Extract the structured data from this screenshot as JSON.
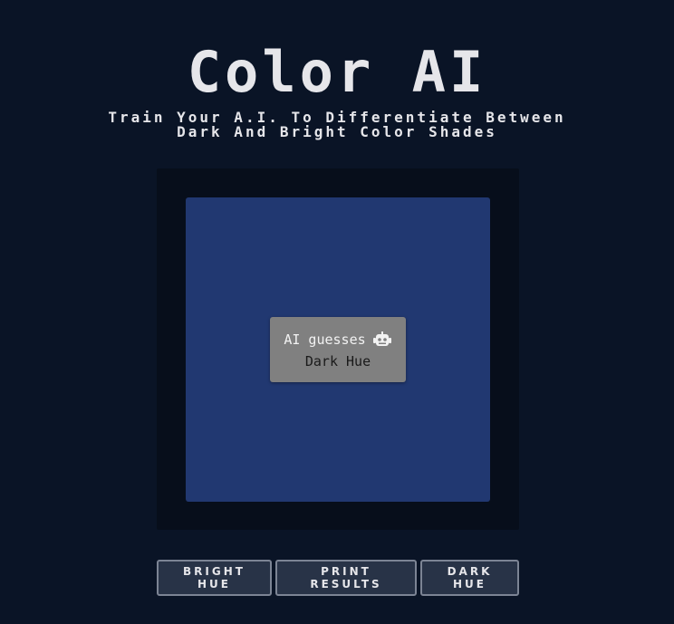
{
  "header": {
    "title": "Color AI",
    "subtitle_line1": "Train Your A.I. To Differentiate Between",
    "subtitle_line2": "Dark And Bright Color Shades"
  },
  "swatch": {
    "color": "#213871"
  },
  "guess": {
    "label": "AI guesses",
    "icon": "robot-icon",
    "value": "Dark Hue"
  },
  "buttons": {
    "bright": {
      "line1": "BRIGHT",
      "line2": "HUE"
    },
    "print": {
      "line1": "PRINT",
      "line2": "RESULTS"
    },
    "dark": {
      "line1": "DARK",
      "line2": "HUE"
    }
  },
  "colors": {
    "background": "#0a1426",
    "frame": "#070e1b",
    "guess_box": "#808080",
    "button_bg": "#283347",
    "button_border": "#7c8494"
  }
}
